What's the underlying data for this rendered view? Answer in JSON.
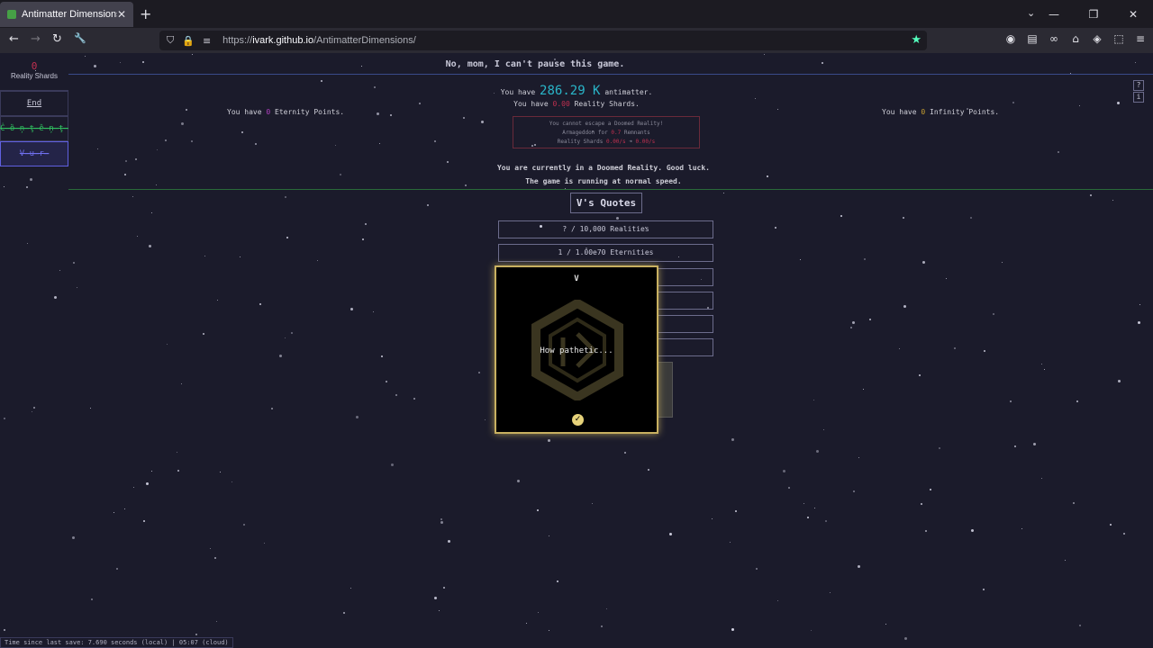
{
  "browser": {
    "tab_title": "Antimatter Dimensions",
    "tab_close": "✕",
    "new_tab": "+",
    "list_tabs": "⌄",
    "window_controls": [
      "—",
      "❐",
      "✕"
    ],
    "url_prefix": "https://",
    "url_domain": "ivark.github.io",
    "url_path": "/AntimatterDimensions/",
    "back": "←",
    "forward": "→",
    "reload": "↻",
    "tools": "🔧",
    "shield": "⛉",
    "lock": "🔒",
    "perm": "≡",
    "bookmark_star": "★",
    "toolbar": [
      "◉",
      "▤",
      "∞",
      "⌂",
      "◈",
      "⬚",
      "≡"
    ]
  },
  "sidebar": {
    "reality_shards_value": "0",
    "reality_shards_label": "Reality Shards",
    "buttons": [
      "End",
      "Ċ̶ȍ̶ņ̶ţ̶ȅ̶ņ̶ţ̶",
      "V̶u̶r̶"
    ]
  },
  "header": {
    "message": "No, mom, I can't pause this game.",
    "help": "?",
    "info": "i"
  },
  "resources": {
    "am_prefix": "You have",
    "am_value": "286.29 K",
    "am_suffix": "antimatter.",
    "rs_prefix": "You have",
    "rs_value": "0.00",
    "rs_suffix": "Reality Shards.",
    "ep_prefix": "You have",
    "ep_value": "0",
    "ep_suffix": "Eternity Points.",
    "ip_prefix": "You have",
    "ip_value": "0",
    "ip_suffix": "Infinity Points."
  },
  "doom_box": {
    "line1": "You cannot escape a Doomed Reality!",
    "line2_prefix": "Armageddon for",
    "line2_value": "0.7",
    "line2_suffix": "Remnants",
    "line3_prefix": "Reality Shards",
    "line3_value1": "0.00/s",
    "line3_arrow": "➜",
    "line3_value2": "0.00/s"
  },
  "status": {
    "line1": "You are currently in a Doomed Reality. Good luck.",
    "line2": "The game is running at normal speed."
  },
  "v_quotes": {
    "title": "V's Quotes",
    "rows": [
      "? / 10,000 Realities",
      "1 / 1.00e70 Eternities",
      "",
      "",
      "",
      ""
    ]
  },
  "modal": {
    "title": "V",
    "text": "How pathetic...",
    "confirm": "✓"
  },
  "save_info": "Time since last save: 7.690 seconds (local) | 05:07 (cloud)",
  "colors": {
    "accent_antimatter": "#2ab5c8",
    "reality_shards": "#c03050",
    "eternity": "#b040c0",
    "infinity": "#c8a030",
    "modal_border": "#c8b060"
  }
}
